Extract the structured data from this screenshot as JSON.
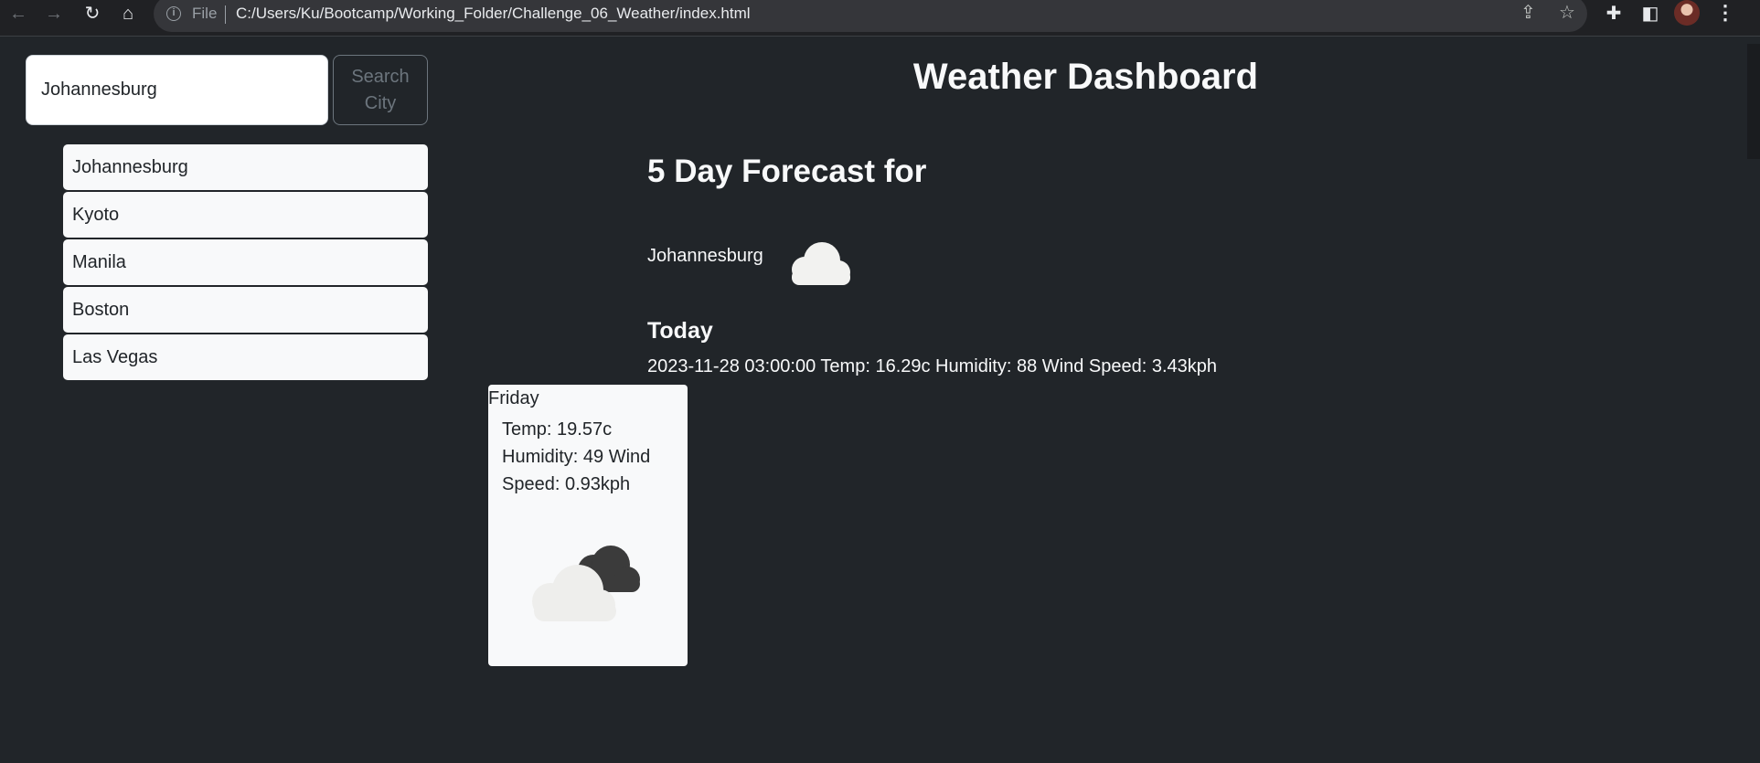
{
  "browser": {
    "file_label": "File",
    "url": "C:/Users/Ku/Bootcamp/Working_Folder/Challenge_06_Weather/index.html",
    "icons": [
      "back-icon",
      "forward-icon",
      "reload-icon",
      "home-icon",
      "info-icon",
      "share-icon",
      "star-icon",
      "extensions-icon",
      "side-panel-icon",
      "profile-avatar",
      "menu-icon"
    ]
  },
  "search": {
    "value": "Johannesburg",
    "button_label": "Search City"
  },
  "history": [
    {
      "label": "Johannesburg"
    },
    {
      "label": "Kyoto"
    },
    {
      "label": "Manila"
    },
    {
      "label": "Boston"
    },
    {
      "label": "Las Vegas"
    }
  ],
  "header": {
    "title": "Weather Dashboard"
  },
  "forecast": {
    "heading": "5 Day Forecast for",
    "city": "Johannesburg",
    "today_icon": "cloud-icon",
    "today_heading": "Today",
    "today_details": "2023-11-28 03:00:00 Temp: 16.29c Humidity: 88 Wind Speed: 3.43kph",
    "cards": [
      {
        "day": "Friday",
        "details": "Temp: 19.57c Humidity: 49 Wind Speed: 0.93kph",
        "icon": "broken-clouds-icon"
      }
    ]
  },
  "colors": {
    "page_bg": "#212529",
    "text_light": "#f8f9fa",
    "card_bg": "#f8f9fa",
    "outline_button": "#6c757d"
  }
}
